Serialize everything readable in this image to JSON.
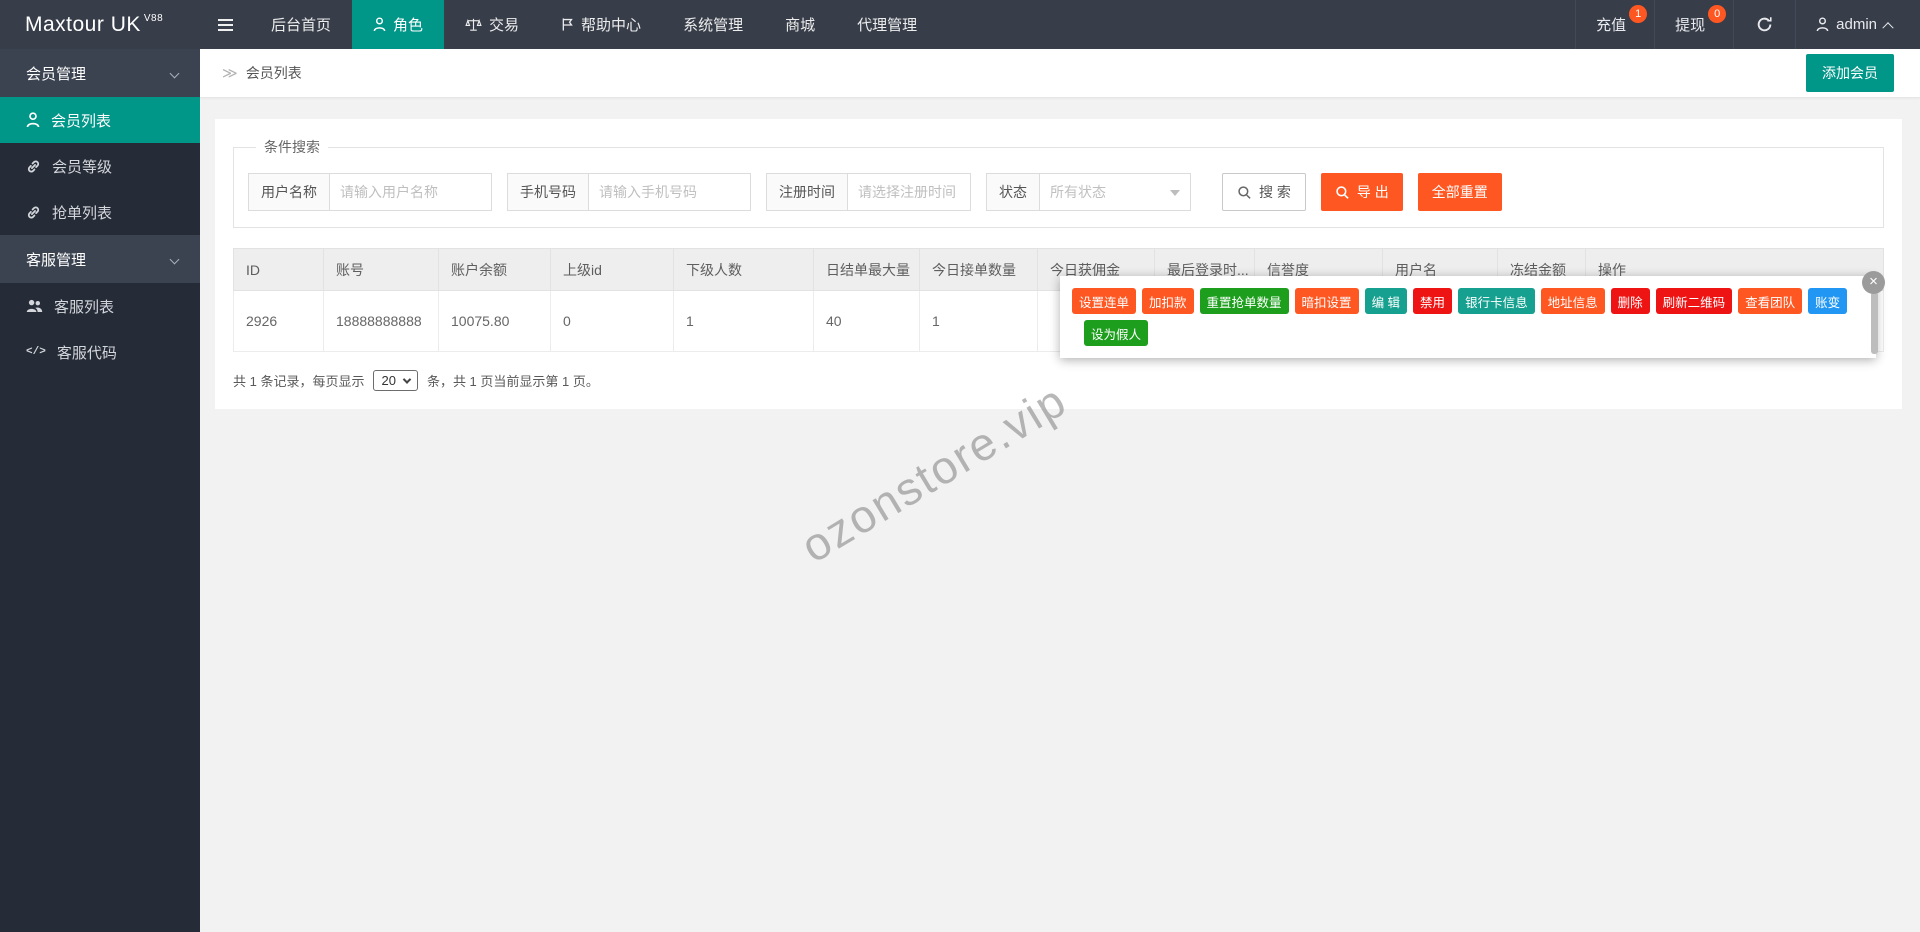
{
  "palette": {
    "accent": "#009688",
    "orange": "#ff5722",
    "green": "#1d9e1d",
    "teal": "#16a08f",
    "red": "#ee1414",
    "blue": "#2196f3",
    "topbar": "#373d49"
  },
  "topbar": {
    "logo": "Maxtour UK",
    "logo_version": "V88",
    "nav": [
      {
        "label": "后台首页"
      },
      {
        "label": "角色",
        "icon": "person-icon",
        "active": true
      },
      {
        "label": "交易",
        "icon": "scales-icon"
      },
      {
        "label": "帮助中心",
        "icon": "flag-icon"
      },
      {
        "label": "系统管理"
      },
      {
        "label": "商城"
      },
      {
        "label": "代理管理"
      }
    ],
    "recharge": {
      "label": "充值",
      "badge": "1"
    },
    "withdraw": {
      "label": "提现",
      "badge": "0"
    },
    "user": {
      "label": "admin"
    }
  },
  "sidebar": {
    "groups": [
      {
        "label": "会员管理",
        "items": [
          {
            "label": "会员列表",
            "icon": "user-icon",
            "active": true
          },
          {
            "label": "会员等级",
            "icon": "link-icon"
          },
          {
            "label": "抢单列表",
            "icon": "link-icon"
          }
        ]
      },
      {
        "label": "客服管理",
        "items": [
          {
            "label": "客服列表",
            "icon": "users-icon"
          },
          {
            "label": "客服代码",
            "icon": "code-icon"
          }
        ]
      }
    ]
  },
  "breadcrumb": {
    "label": "会员列表"
  },
  "page": {
    "add_button": "添加会员"
  },
  "search": {
    "legend": "条件搜索",
    "fields": [
      {
        "label": "用户名称",
        "placeholder": "请输入用户名称"
      },
      {
        "label": "手机号码",
        "placeholder": "请输入手机号码"
      },
      {
        "label": "注册时间",
        "placeholder": "请选择注册时间"
      }
    ],
    "status": {
      "label": "状态",
      "value": "所有状态"
    },
    "search_label": "搜 索",
    "export_label": "导 出",
    "reset_label": "全部重置"
  },
  "table": {
    "headers": [
      "ID",
      "账号",
      "账户余额",
      "上级id",
      "下级人数",
      "日结单最大量",
      "今日接单数量",
      "今日获佣金",
      "最后登录时...",
      "信誉度",
      "用户名",
      "冻结金额",
      "操作"
    ],
    "row": [
      "2926",
      "18888888888",
      "10075.80",
      "0",
      "1",
      "40",
      "1"
    ]
  },
  "popup": {
    "buttons": [
      {
        "label": "设置连单",
        "color": "orange"
      },
      {
        "label": "加扣款",
        "color": "orange"
      },
      {
        "label": "重置抢单数量",
        "color": "green"
      },
      {
        "label": "暗扣设置",
        "color": "orange"
      },
      {
        "label": "编 辑",
        "color": "teal"
      },
      {
        "label": "禁用",
        "color": "red"
      },
      {
        "label": "银行卡信息",
        "color": "teal"
      },
      {
        "label": "地址信息",
        "color": "orange"
      },
      {
        "label": "删除",
        "color": "red"
      },
      {
        "label": "刷新二维码",
        "color": "red"
      },
      {
        "label": "查看团队",
        "color": "orange"
      },
      {
        "label": "账变",
        "color": "blue"
      },
      {
        "label": "设为假人",
        "color": "green"
      }
    ],
    "close": "×"
  },
  "pagination": {
    "prefix": "共 1 条记录，每页显示",
    "page_size": "20",
    "suffix": "条，共 1 页当前显示第 1 页。"
  },
  "watermark": "ozonstore.vip"
}
